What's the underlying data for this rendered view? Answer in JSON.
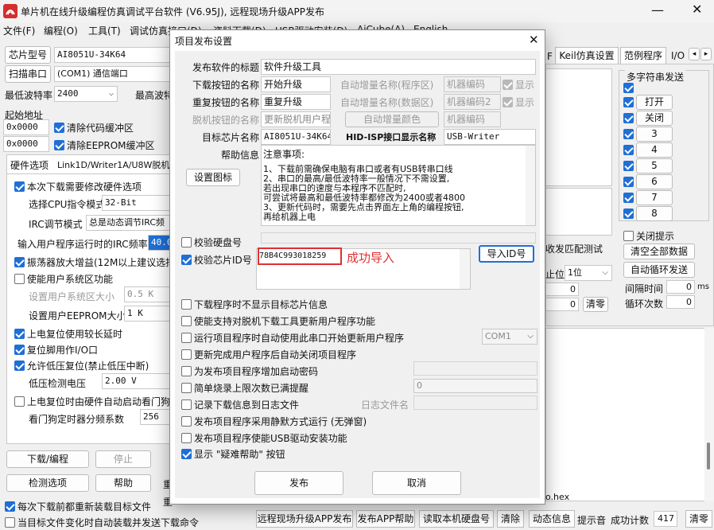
{
  "app": {
    "title": "单片机在线升级编程仿真调试平台软件 (V6.95J), 远程现场升级APP发布"
  },
  "menu": [
    "文件(F)",
    "编程(O)",
    "工具(T)",
    "调试仿真接口(D)",
    "资料下载(D)",
    "USB驱动安装(D)",
    "AiCube(A)",
    "English"
  ],
  "left": {
    "chip_model_label": "芯片型号",
    "chip_model_value": "AI8051U-34K64",
    "scan_port_label": "扫描串口",
    "scan_port_value": "(COM1) 通信端口",
    "min_baud_label": "最低波特率",
    "min_baud_value": "2400",
    "max_baud_label": "最高波特",
    "start_addr_label": "起始地址",
    "addr1": "0x0000",
    "clear_code_buffer": "清除代码缓冲区",
    "addr2": "0x0000",
    "clear_eeprom_buffer": "清除EEPROM缓冲区",
    "hw_tab": "硬件选项",
    "tab2": "Link1D/Writer1A/U8W脱机",
    "opt_modify_hw": "本次下载需要修改硬件选项",
    "cpu_mode_label": "选择CPU指令模式",
    "cpu_mode_value": "32-Bit",
    "irc_mode_label": "IRC调节模式",
    "irc_mode_value": "总是动态调节IRC频",
    "irc_freq_label": "输入用户程序运行时的IRC频率",
    "irc_freq_value": "40.0",
    "osc_gain": "振荡器放大增益(12M以上建议选择",
    "user_eeprom_func": "使能用户系统区功能",
    "sys_size_label": "设置用户系统区大小",
    "sys_size_value": "0.5 K",
    "eeprom_size_label": "设置用户EEPROM大小",
    "eeprom_size_value": "1    K",
    "power_reset_delay": "上电复位使用较长延时",
    "reset_pin_io": "复位脚用作I/O口",
    "low_volt_reset": "允许低压复位(禁止低压中断)",
    "low_volt_label": "低压检测电压",
    "low_volt_value": "2.00 V",
    "watchdog_auto": "上电复位时由硬件自动启动看门狗",
    "watchdog_div_label": "看门狗定时器分频系数",
    "watchdog_div_value": "256",
    "download_btn": "下载/编程",
    "stop_btn": "停止",
    "check_btn": "检测选项",
    "help_btn": "帮助",
    "reprog_btn1": "重",
    "reprog_btn2": "重",
    "reload_before": "每次下载前都重新装载目标文件",
    "auto_load": "当目标文件变化时自动装载并发送下载命令"
  },
  "right": {
    "tab_keil": "Keil仿真设置",
    "tab_examples": "范例程序",
    "tab_io": "I/O",
    "multi_send_label": "多字符串发送",
    "send_open": "打开",
    "send_close": "关闭",
    "send_labels": [
      "3",
      "4",
      "5",
      "6",
      "7",
      "8"
    ],
    "close_hint": "关闭提示",
    "clear_all": "清空全部数据",
    "auto_loop": "自动循环发送",
    "interval_label": "间隔时间",
    "interval_value": "0",
    "interval_unit": "ms",
    "loop_count_label": "循环次数",
    "loop_count_value": "0",
    "recv_match": "收发匹配测试",
    "stop_bit_label": "止位",
    "stop_bit_value": "1位",
    "count_value_1": "0",
    "count_value_2": "0",
    "clear_btn": "清零",
    "hex_file": "o.hex"
  },
  "statusbar": {
    "remote_publish": "远程现场升级APP发布",
    "publish_help": "发布APP帮助",
    "read_disk": "读取本机硬盘号",
    "clear": "清除",
    "dynamic_info": "动态信息",
    "prompt_sound": "提示音",
    "success_count_label": "成功计数",
    "success_count_value": "417",
    "reset": "清零"
  },
  "dialog": {
    "title": "项目发布设置",
    "software_title_label": "发布软件的标题",
    "software_title_value": "软件升级工具",
    "download_btn_label": "下载按钮的名称",
    "download_btn_value": "开始升级",
    "reprog_btn_label": "重复按钮的名称",
    "reprog_btn_value": "重复升级",
    "offline_btn_label": "脱机按钮的名称",
    "offline_btn_value": "更新脱机用户程",
    "auto_inc_prog": "自动增量名称(程序区)",
    "machine_code": "机器编码",
    "show1": "显示",
    "auto_inc_data": "自动增量名称(数据区)",
    "machine_code2": "机器编码2",
    "show2": "显示",
    "auto_inc_color": "自动增量颜色",
    "machine_code3": "机器编码",
    "target_chip_label": "目标芯片名称",
    "target_chip_value": "AI8051U-34K64",
    "hid_label": "HID-ISP接口显示名称",
    "hid_value": "USB-Writer",
    "help_info_label": "帮助信息",
    "help_lines": [
      "注意事项:",
      "    1、下载前需确保电脑有串口或者有USB转串口线",
      "    2、串口的最高/最低波特率一般情况下不需设置,",
      "       若出现串口的速度与本程序不匹配时,",
      "       可尝试将最高和最低波特率都修改为2400或者4800",
      "    3、更新代码时，需要先点击界面左上角的编程按钮,",
      "       再给机器上电"
    ],
    "set_icon_btn": "设置图标",
    "check_disk": "校验硬盘号",
    "check_chip_id": "校验芯片ID号",
    "chip_id_value": "78B4C993018259",
    "import_success": "成功导入",
    "import_id_btn": "导入ID号",
    "opt_no_target_info": "下载程序时不显示目标芯片信息",
    "opt_multi_load": "使能支持对脱机下载工具更新用户程序功能",
    "opt_auto_serial": "运行项目程序时自动使用此串口开始更新用户程序",
    "com_value": "COM1",
    "opt_auto_close": "更新完成用户程序后自动关闭项目程序",
    "opt_password": "为发布项目程序增加启动密码",
    "opt_limit": "简单烧录上限次数已满提醒",
    "limit_value": "0",
    "opt_log": "记录下载信息到日志文件",
    "log_file_label": "日志文件名",
    "opt_silent": "发布项目程序采用静默方式运行 (无弹窗)",
    "opt_usb_driver": "发布项目程序使能USB驱动安装功能",
    "opt_show_help": "显示 \"疑难帮助\" 按钮",
    "publish_btn": "发布",
    "cancel_btn": "取消"
  }
}
